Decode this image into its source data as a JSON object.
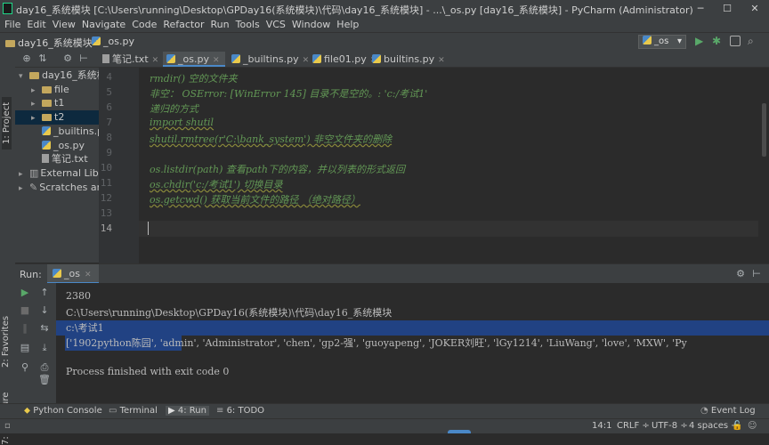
{
  "window": {
    "title": "day16_系统模块 [C:\\Users\\running\\Desktop\\GPDay16(系统模块)\\代码\\day16_系统模块] - ...\\_os.py [day16_系统模块] - PyCharm (Administrator)",
    "minimize": "─",
    "maximize": "☐",
    "close": "✕"
  },
  "menu": [
    "File",
    "Edit",
    "View",
    "Navigate",
    "Code",
    "Refactor",
    "Run",
    "Tools",
    "VCS",
    "Window",
    "Help"
  ],
  "nav": {
    "project": "day16_系统模块",
    "file": "_os.py",
    "run_config": "_os"
  },
  "left_stripe": {
    "project": "1: Project",
    "favorites": "2: Favorites",
    "structure": "7: Structure"
  },
  "project_tree": [
    {
      "label": "day16_系统模",
      "type": "folder",
      "indent": 0,
      "expanded": true
    },
    {
      "label": "file",
      "type": "folder",
      "indent": 1
    },
    {
      "label": "t1",
      "type": "folder",
      "indent": 1
    },
    {
      "label": "t2",
      "type": "folder",
      "indent": 1,
      "selected": true
    },
    {
      "label": "_builtins.p",
      "type": "py",
      "indent": 1
    },
    {
      "label": "_os.py",
      "type": "py",
      "indent": 1
    },
    {
      "label": "笔记.txt",
      "type": "txt",
      "indent": 1
    },
    {
      "label": "External Libra",
      "type": "lib",
      "indent": 0
    },
    {
      "label": "Scratches and",
      "type": "scratch",
      "indent": 0
    }
  ],
  "tabs": [
    {
      "label": "笔记.txt",
      "type": "txt",
      "active": false
    },
    {
      "label": "_os.py",
      "type": "py",
      "active": true
    },
    {
      "label": "_builtins.py",
      "type": "py",
      "active": false
    },
    {
      "label": "file01.py",
      "type": "py",
      "active": false
    },
    {
      "label": "builtins.py",
      "type": "py",
      "active": false
    }
  ],
  "editor": {
    "line_numbers": [
      "4",
      "5",
      "6",
      "7",
      "8",
      "9",
      "10",
      "11",
      "12",
      "13",
      "14"
    ],
    "lines": [
      "rmdir()   空的文件夹",
      "非空： OSError: [WinError 145] 目录不是空的。: 'c:/考试1'",
      "递归的方式",
      "import shutil",
      "shutil.rmtree(r'C:\\bank_system')    非空文件夹的删除",
      "",
      "os.listdir(path)  查看path下的内容，并以列表的形式返回",
      "os.chdir('c:/考试1')   切换目录",
      "os.getcwd()  获取当前文件的路径 （绝对路径）",
      "",
      ""
    ]
  },
  "run": {
    "label": "Run:",
    "tab": "_os",
    "output": [
      "2380",
      "2380",
      "C:\\Users\\running\\Desktop\\GPDay16(系统模块)\\代码\\day16_系统模块",
      "c:\\考试1",
      "['1902python陈园', 'admin', 'Administrator', 'chen', 'gp2-强', 'guoyapeng', 'JOKER刘旺', 'lGy1214', 'LiuWang', 'love', 'MXW', 'Py",
      "",
      "Process finished with exit code 0"
    ]
  },
  "bottom_tools": [
    "Python Console",
    "Terminal",
    "4: Run",
    "6: TODO"
  ],
  "event_log": "Event Log",
  "status": {
    "position": "14:1",
    "line_sep": "CRLF ÷",
    "encoding": "UTF-8 ÷",
    "indent": "4 spaces ÷"
  },
  "colors": {
    "accent": "#4a88c7",
    "selection": "#214283",
    "comment": "#629755",
    "run_green": "#59a869"
  }
}
